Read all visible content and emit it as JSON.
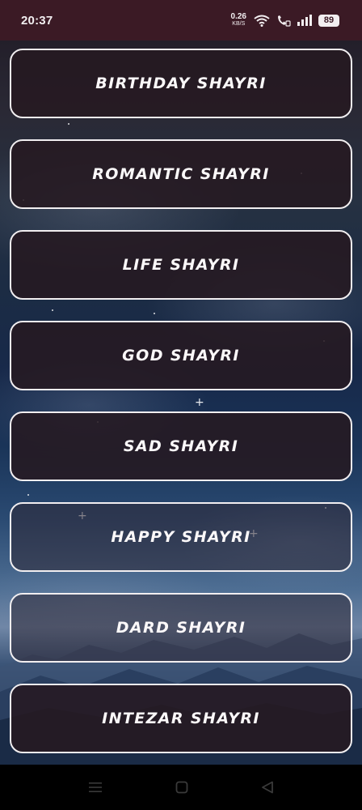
{
  "status_bar": {
    "time": "20:37",
    "net_speed_value": "0.26",
    "net_speed_unit": "KB/S",
    "battery": "89",
    "icons": [
      "wifi-icon",
      "volte-call-icon",
      "signal-icon",
      "battery-icon"
    ]
  },
  "categories": [
    {
      "label": "BIRTHDAY SHAYRI"
    },
    {
      "label": "ROMANTIC SHAYRI"
    },
    {
      "label": "LIFE SHAYRI"
    },
    {
      "label": "GOD SHAYRI"
    },
    {
      "label": "SAD SHAYRI"
    },
    {
      "label": "HAPPY SHAYRI"
    },
    {
      "label": "DARD SHAYRI"
    },
    {
      "label": "INTEZAR SHAYRI"
    }
  ],
  "nav_bar": {
    "icons": [
      "menu-icon",
      "home-square-icon",
      "back-triangle-icon"
    ]
  },
  "colors": {
    "status_bar_bg": "#3b1a25",
    "button_border": "#f1eef0",
    "button_bg": "#261921",
    "label_text": "#fbf8f9"
  }
}
